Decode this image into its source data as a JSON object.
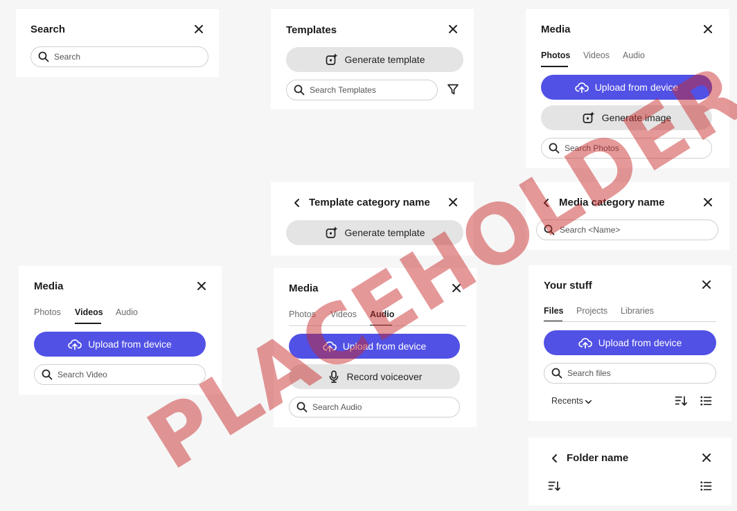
{
  "watermark": "PLACEHOLDER",
  "colors": {
    "accent": "#5151e5",
    "secondary_button": "#e4e4e4",
    "watermark": "#c82828"
  },
  "search_panel": {
    "title": "Search",
    "search_placeholder": "Search"
  },
  "templates_panel": {
    "title": "Templates",
    "generate_label": "Generate template",
    "search_placeholder": "Search Templates"
  },
  "media_photos_panel": {
    "title": "Media",
    "tabs": [
      "Photos",
      "Videos",
      "Audio"
    ],
    "active_tab": "Photos",
    "upload_label": "Upload from device",
    "generate_label": "Generate image",
    "search_placeholder": "Search Photos"
  },
  "template_category_panel": {
    "title": "Template category name",
    "generate_label": "Generate template"
  },
  "media_category_panel": {
    "title": "Media category name",
    "search_placeholder": "Search <Name>"
  },
  "media_videos_panel": {
    "title": "Media",
    "tabs": [
      "Photos",
      "Videos",
      "Audio"
    ],
    "active_tab": "Videos",
    "upload_label": "Upload from device",
    "search_placeholder": "Search Video"
  },
  "media_audio_panel": {
    "title": "Media",
    "tabs": [
      "Photos",
      "Videos",
      "Audio"
    ],
    "active_tab": "Audio",
    "upload_label": "Upload from device",
    "record_label": "Record voiceover",
    "search_placeholder": "Search Audio"
  },
  "your_stuff_panel": {
    "title": "Your stuff",
    "tabs": [
      "Files",
      "Projects",
      "Libraries"
    ],
    "active_tab": "Files",
    "upload_label": "Upload from device",
    "search_placeholder": "Search files",
    "sort_label": "Recents"
  },
  "folder_panel": {
    "title": "Folder name"
  }
}
